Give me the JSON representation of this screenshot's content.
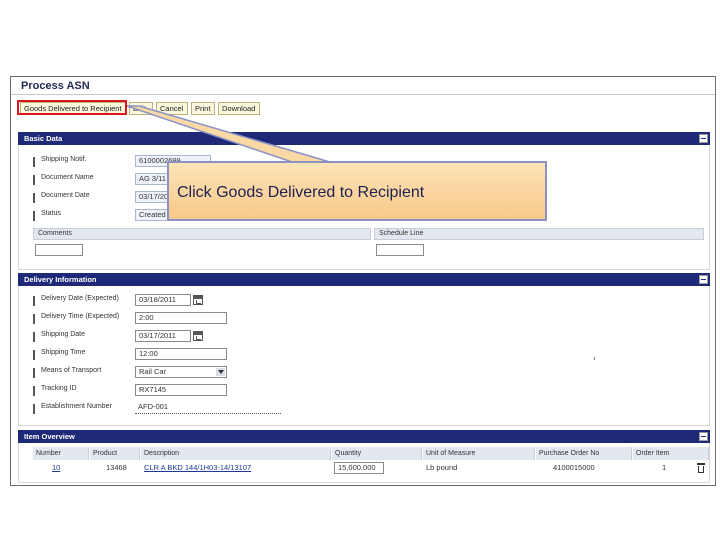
{
  "page": {
    "title": "Process ASN"
  },
  "toolbar": {
    "buttons": [
      "Goods Delivered to Recipient",
      "Edit",
      "Cancel",
      "Print",
      "Download"
    ]
  },
  "basic_data": {
    "heading": "Basic Data",
    "fields": [
      {
        "label": "Shipping Notif.",
        "value": "6100002699"
      },
      {
        "label": "Document Name",
        "value": "AG 3/11"
      },
      {
        "label": "Document Date",
        "value": "03/17/2011"
      },
      {
        "label": "Status",
        "value": "Created"
      }
    ],
    "comments_label": "Comments",
    "schedule_line_label": "Schedule Line"
  },
  "delivery": {
    "heading": "Delivery Information",
    "fields": [
      {
        "label": "Delivery Date (Expected)",
        "value": "03/18/2011"
      },
      {
        "label": "Delivery Time (Expected)",
        "value": "2:00"
      },
      {
        "label": "Shipping Date",
        "value": "03/17/2011"
      },
      {
        "label": "Shipping Time",
        "value": "12:00"
      },
      {
        "label": "Means of Transport",
        "value": "Rail Car"
      },
      {
        "label": "Tracking ID",
        "value": "RX7145"
      },
      {
        "label": "Establishment Number",
        "value": "AFD-001"
      }
    ]
  },
  "item_overview": {
    "heading": "Item Overview",
    "columns": [
      "Number",
      "Product",
      "Description",
      "Quantity",
      "Unit of Measure",
      "Purchase Order No",
      "Order Item"
    ],
    "rows": [
      {
        "number": "10",
        "product": "13468",
        "description": "CLR A BKD 144/1H03-14/13107",
        "quantity": "15,000.000",
        "unit": "Lb pound",
        "po_no": "4100015000",
        "order_item": "1"
      }
    ]
  },
  "callout": {
    "text": "Click Goods Delivered to Recipient"
  },
  "colors": {
    "section_header": "#1e2a78",
    "highlight": "#e0151b",
    "callout_bg": "#f8c88a",
    "callout_border": "#8a92c4"
  }
}
